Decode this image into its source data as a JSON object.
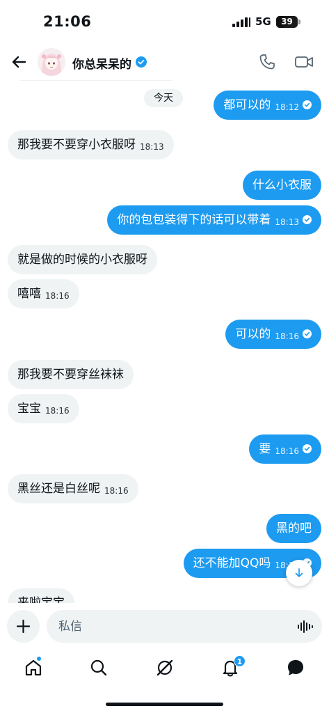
{
  "status_bar": {
    "time": "21:06",
    "network": "5G",
    "battery": "39",
    "battery_level_percent": 39
  },
  "header": {
    "contact_name": "你总呆呆的"
  },
  "conversation": {
    "date_label": "今天",
    "messages": [
      {
        "dir": "out",
        "text": "都可以的",
        "time": "18:12",
        "read": true
      },
      {
        "dir": "in",
        "text": "那我要不要穿小衣服呀",
        "time": "18:13"
      },
      {
        "dir": "out",
        "text": "什么小衣服",
        "time": ""
      },
      {
        "dir": "out",
        "text": "你的包包装得下的话可以带着",
        "time": "18:13",
        "read": true
      },
      {
        "dir": "in",
        "text": "就是做的时候的小衣服呀",
        "time": ""
      },
      {
        "dir": "in",
        "text": "嘻嘻",
        "time": "18:16"
      },
      {
        "dir": "out",
        "text": "可以的",
        "time": "18:16",
        "read": true
      },
      {
        "dir": "in",
        "text": "那我要不要穿丝袜袜",
        "time": ""
      },
      {
        "dir": "in",
        "text": "宝宝",
        "time": "18:16"
      },
      {
        "dir": "out",
        "text": "要",
        "time": "18:16",
        "read": true
      },
      {
        "dir": "in",
        "text": "黑丝还是白丝呢",
        "time": "18:16"
      },
      {
        "dir": "out",
        "text": "黑的吧",
        "time": ""
      },
      {
        "dir": "out",
        "text": "还不能加QQ吗",
        "time": "18:16",
        "read": true
      },
      {
        "dir": "in",
        "text": "来啦宝宝",
        "time": ""
      }
    ]
  },
  "composer": {
    "placeholder": "私信"
  },
  "tab_bar": {
    "notifications_count": "1"
  },
  "colors": {
    "accent": "#1d9bf0",
    "bubble_in": "#eff3f4",
    "text": "#0f1419"
  },
  "icons": [
    "back-arrow-icon",
    "verified-badge-icon",
    "phone-icon",
    "video-camera-icon",
    "read-check-icon",
    "arrow-down-icon",
    "plus-icon",
    "voice-wave-icon",
    "home-icon",
    "search-icon",
    "grok-icon",
    "bell-icon",
    "messages-icon"
  ]
}
